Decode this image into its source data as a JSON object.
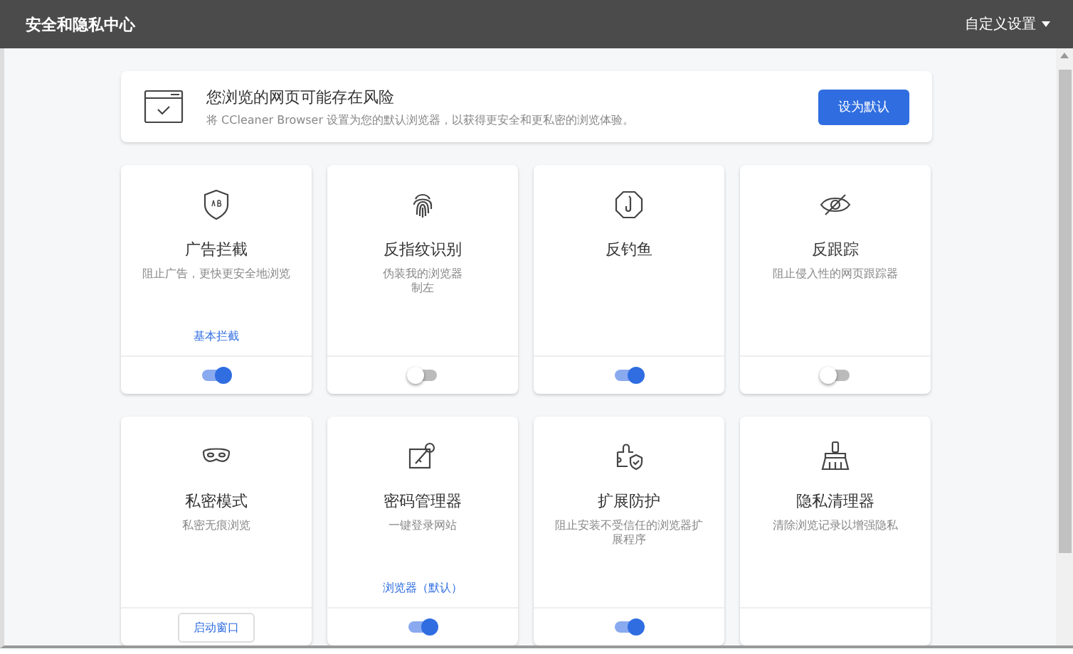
{
  "header": {
    "title": "安全和隐私中心",
    "menu": "自定义设置"
  },
  "banner": {
    "title": "您浏览的网页可能存在风险",
    "text": "将 CCleaner Browser 设置为您的默认浏览器，以获得更安全和更私密的浏览体验。",
    "button": "设为默认"
  },
  "cards": [
    {
      "title": "广告拦截",
      "desc": [
        "阻止广告，更快更安全地浏览"
      ],
      "link": "基本拦截",
      "footer": {
        "kind": "toggle",
        "on": true
      }
    },
    {
      "title": "反指纹识别",
      "desc": [
        "伪装我的浏览器",
        "制左"
      ],
      "footer": {
        "kind": "toggle",
        "on": false
      }
    },
    {
      "title": "反钓鱼",
      "footer": {
        "kind": "toggle",
        "on": true
      }
    },
    {
      "title": "反跟踪",
      "desc": [
        "阻止侵入性的网页跟踪器"
      ],
      "footer": {
        "kind": "toggle",
        "on": false
      }
    },
    {
      "title": "私密模式",
      "desc": [
        "私密无痕浏览"
      ],
      "footer": {
        "kind": "button",
        "label": "启动窗口"
      }
    },
    {
      "title": "密码管理器",
      "desc": [
        "一键登录网站"
      ],
      "link": "浏览器（默认）",
      "footer": {
        "kind": "toggle",
        "on": true
      }
    },
    {
      "title": "扩展防护",
      "desc": [
        "阻止安装不受信任的浏览器扩",
        "展程序"
      ],
      "footer": {
        "kind": "toggle",
        "on": true
      }
    },
    {
      "title": "隐私清理器",
      "desc": [
        "清除浏览记录以增强隐私"
      ],
      "footer": {
        "kind": "none"
      }
    }
  ]
}
